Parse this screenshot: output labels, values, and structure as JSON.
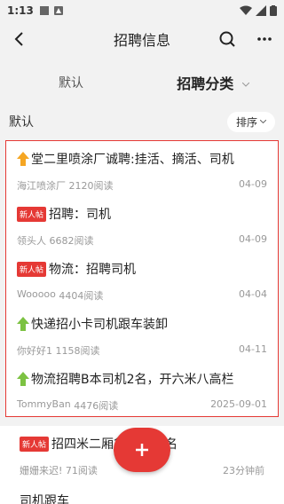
{
  "status_bar": {
    "time": "1:13"
  },
  "header": {
    "title": "招聘信息"
  },
  "tabs": [
    {
      "label": "默认",
      "active": false
    },
    {
      "label": "招聘分类",
      "active": true
    }
  ],
  "sort_row": {
    "label": "默认",
    "sort_button": "排序"
  },
  "highlighted_items": [
    {
      "title": "堂二里喷涂厂诚聘:挂活、摘活、司机",
      "prefix": "arrow-up-orange",
      "author": "海江喷涂厂",
      "reads": "2120阅读",
      "date": "04-09"
    },
    {
      "title": "招聘：司机",
      "prefix": "badge",
      "badge": "新人帖",
      "author": "领头人",
      "reads": "6682阅读",
      "date": "04-09"
    },
    {
      "title": "物流：招聘司机",
      "prefix": "badge",
      "badge": "新人帖",
      "author": "Wooooo",
      "reads": "4404阅读",
      "date": "04-04"
    },
    {
      "title": "快递招小卡司机跟车装卸",
      "prefix": "arrow-up-green",
      "author": "你好好1",
      "reads": "1158阅读",
      "date": "04-11"
    },
    {
      "title": "物流招聘B本司机2名，开六米八高栏",
      "prefix": "arrow-up-green",
      "author": "TommyBan",
      "reads": "4476阅读",
      "date": "2025-09-01"
    }
  ],
  "outside_item": {
    "badge": "新人帖",
    "title": "招四米二厢货",
    "title_tail": "名",
    "author": "姗姗来迟!",
    "reads": "71阅读",
    "date": "23分钟前"
  },
  "last_item": {
    "title": "司机跟车"
  },
  "colors": {
    "accent": "#e53935",
    "arrow_orange": "#f5a623",
    "arrow_green": "#7cc242"
  }
}
